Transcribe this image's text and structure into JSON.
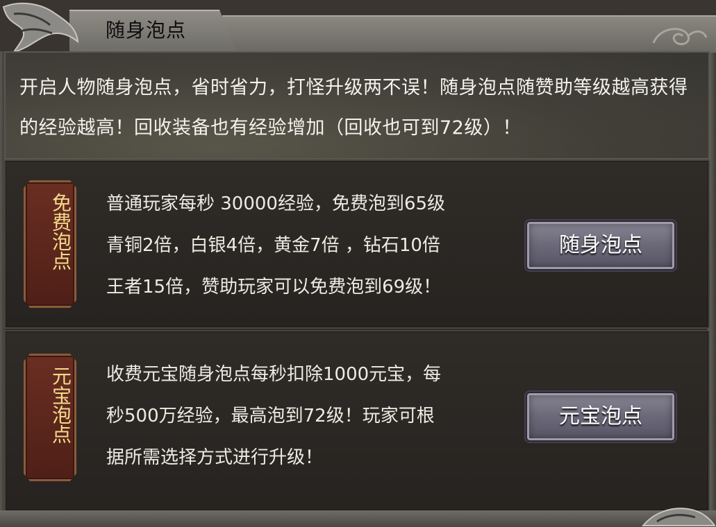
{
  "window": {
    "title": "随身泡点"
  },
  "intro": {
    "text": "开启人物随身泡点，省时省力，打怪升级两不误！随身泡点随赞助等级越高获得的经验越高！回收装备也有经验增加（回收也可到72级）！"
  },
  "free_section": {
    "tag": "免费泡点",
    "lines": [
      "普通玩家每秒 30000经验，免费泡到65级",
      "青铜2倍，白银4倍，黄金7倍 ，钻石10倍",
      "王者15倍，赞助玩家可以免费泡到69级！"
    ],
    "button_label": "随身泡点"
  },
  "ingot_section": {
    "tag": "元宝泡点",
    "lines": [
      "收费元宝随身泡点每秒扣除1000元宝，每",
      "秒500万经验，最高泡到72级！玩家可根",
      "据所需选择方式进行升级！"
    ],
    "button_label": "元宝泡点"
  },
  "icons": {
    "top_left": "dragon-ornament-icon",
    "top_right": "swirl-ornament-icon",
    "bottom_right": "dragon-ornament-icon"
  },
  "colors": {
    "tag_text": "#f3dc8a",
    "tag_background": "#5a2519",
    "body_text": "#eeebe5",
    "button_face": "#6d6a7a"
  }
}
